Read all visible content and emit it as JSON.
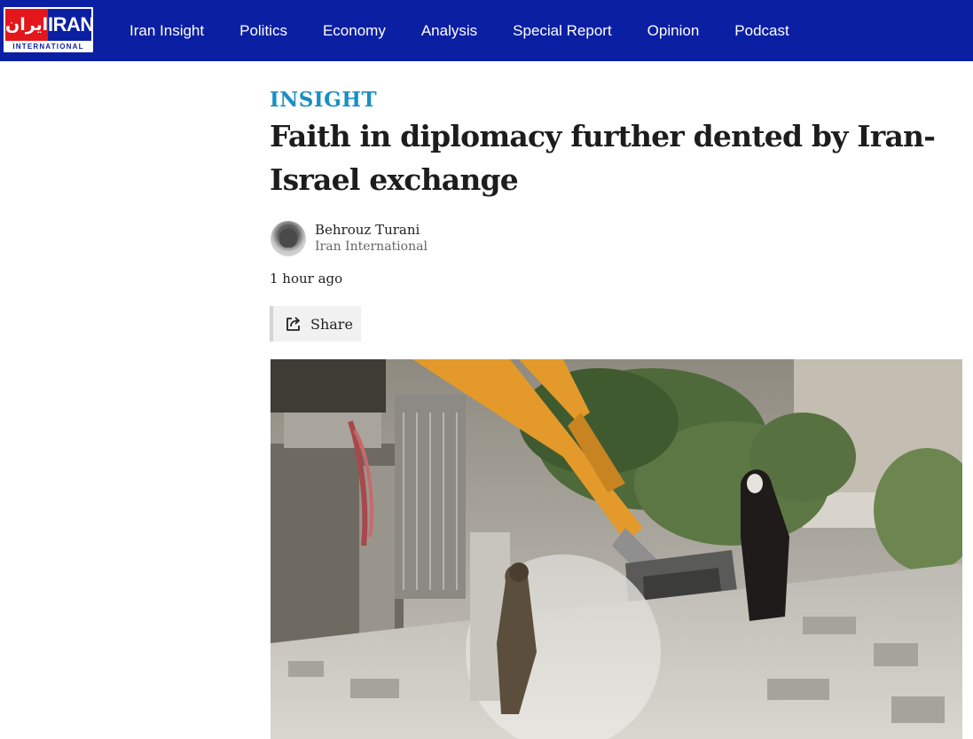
{
  "header": {
    "logo": {
      "farsi_text": "ایران",
      "latin_text": "IRAN",
      "sub_text": "INTERNATIONAL"
    },
    "nav": [
      {
        "label": "Iran Insight"
      },
      {
        "label": "Politics"
      },
      {
        "label": "Economy"
      },
      {
        "label": "Analysis"
      },
      {
        "label": "Special Report"
      },
      {
        "label": "Opinion"
      },
      {
        "label": "Podcast"
      }
    ],
    "colors": {
      "bar": "#0b1fa3",
      "logo_red": "#e3161b"
    }
  },
  "article": {
    "kicker": "INSIGHT",
    "headline": "Faith in diplomacy further dented by Iran-Israel exchange",
    "author": {
      "name": "Behrouz Turani",
      "organization": "Iran International"
    },
    "published": "1 hour ago",
    "share_label": "Share",
    "share_icon": "share-icon",
    "kicker_color": "#1a8fc4"
  }
}
